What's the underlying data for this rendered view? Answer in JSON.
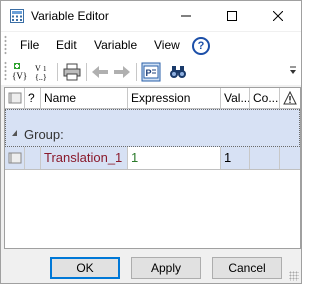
{
  "window": {
    "title": "Variable Editor"
  },
  "menu": {
    "items": [
      "File",
      "Edit",
      "Variable",
      "View"
    ],
    "help_label": "?"
  },
  "toolbar": {
    "buttons": [
      {
        "name": "add-variable-icon"
      },
      {
        "name": "add-group-icon"
      },
      {
        "name": "print-icon"
      },
      {
        "name": "undo-icon"
      },
      {
        "name": "redo-icon"
      },
      {
        "name": "parameter-view-icon"
      },
      {
        "name": "find-icon"
      }
    ]
  },
  "grid": {
    "columns": [
      "",
      "?",
      "Name",
      "Expression",
      "Val...",
      "Co...",
      ""
    ],
    "group_label": "Group:",
    "rows": [
      {
        "name": "Translation_1",
        "expression": "1",
        "value": "1",
        "comment": ""
      }
    ]
  },
  "buttons": {
    "ok": "OK",
    "apply": "Apply",
    "cancel": "Cancel"
  },
  "colors": {
    "name_text": "#8a1a2c",
    "expression_text": "#2a7a2a",
    "row_bg": "#d7e1f4",
    "accent": "#0078d7"
  }
}
